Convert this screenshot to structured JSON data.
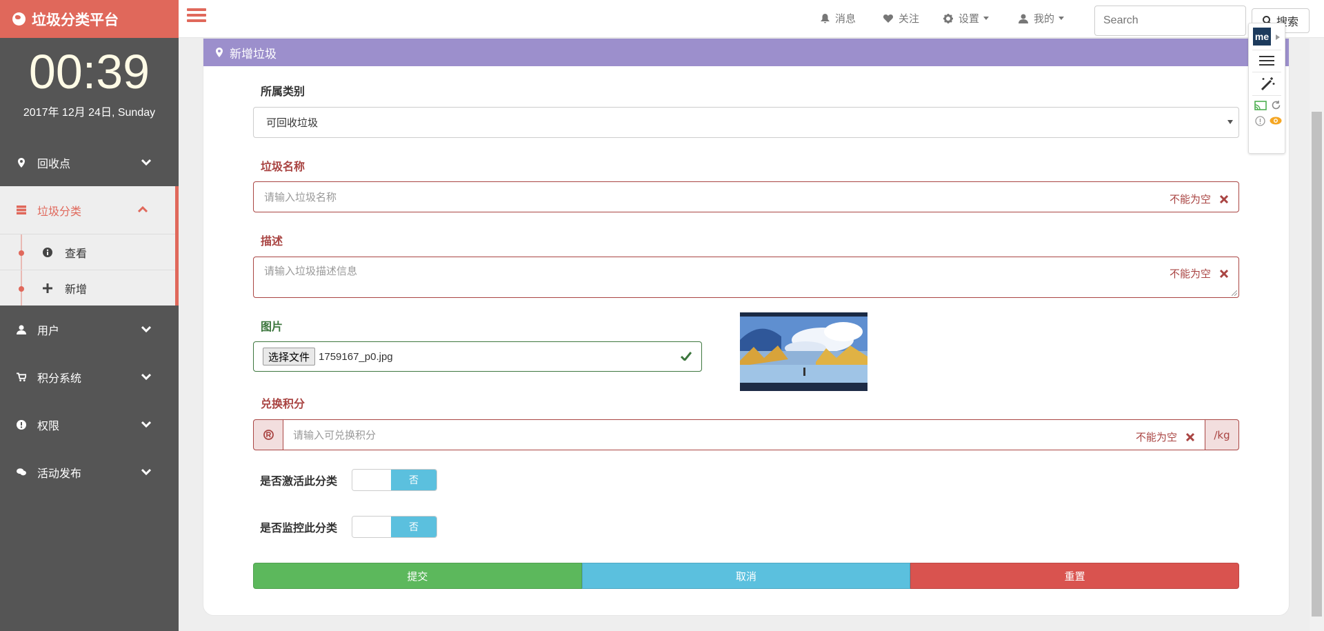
{
  "brand": {
    "title": "垃圾分类平台"
  },
  "clock": {
    "time": "00:39",
    "date": "2017年 12月 24日, Sunday"
  },
  "sidebar": {
    "items": [
      {
        "label": "回收点"
      },
      {
        "label": "垃圾分类",
        "sub": [
          {
            "label": "查看"
          },
          {
            "label": "新增"
          }
        ]
      },
      {
        "label": "用户"
      },
      {
        "label": "积分系统"
      },
      {
        "label": "权限"
      },
      {
        "label": "活动发布"
      }
    ]
  },
  "topbar": {
    "messages": "消息",
    "follow": "关注",
    "settings": "设置",
    "mine": "我的",
    "search_placeholder": "Search",
    "search_button": "搜索"
  },
  "panel": {
    "title": "新增垃圾"
  },
  "form": {
    "category": {
      "label": "所属类别",
      "value": "可回收垃圾"
    },
    "name": {
      "label": "垃圾名称",
      "placeholder": "请输入垃圾名称",
      "error": "不能为空"
    },
    "desc": {
      "label": "描述",
      "placeholder": "请输入垃圾描述信息",
      "error": "不能为空"
    },
    "image": {
      "label": "图片",
      "button": "选择文件",
      "filename": "1759167_p0.jpg"
    },
    "points": {
      "label": "兑换积分",
      "placeholder": "请输入可兑换积分",
      "error": "不能为空",
      "unit": "/kg"
    },
    "active": {
      "label": "是否激活此分类",
      "state": "否"
    },
    "monitor": {
      "label": "是否监控此分类",
      "state": "否"
    },
    "buttons": {
      "submit": "提交",
      "cancel": "取消",
      "reset": "重置"
    }
  },
  "extension": {
    "logo": "me"
  },
  "colors": {
    "brand": "#e0685b",
    "panel_header": "#9c8fcc",
    "error": "#a94442",
    "success": "#3c763d",
    "green": "#5cb85c",
    "blue": "#5bc0de",
    "red": "#d9534f"
  }
}
